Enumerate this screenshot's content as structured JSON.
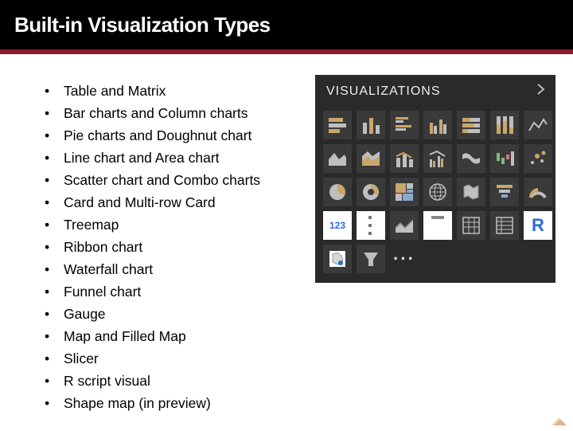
{
  "title": "Built-in Visualization Types",
  "bullets": [
    "Table and Matrix",
    "Bar charts and Column charts",
    "Pie charts and Doughnut chart",
    "Line chart and Area chart",
    "Scatter chart and Combo charts",
    "Card and Multi-row Card",
    "Treemap",
    "Ribbon chart",
    "Waterfall chart",
    "Funnel chart",
    "Gauge",
    "Map and Filled Map",
    "Slicer",
    "R script visual",
    "Shape map (in preview)"
  ],
  "panel": {
    "header": "VISUALIZATIONS",
    "card_label": "123",
    "r_label": "R",
    "ellipsis": "···"
  }
}
